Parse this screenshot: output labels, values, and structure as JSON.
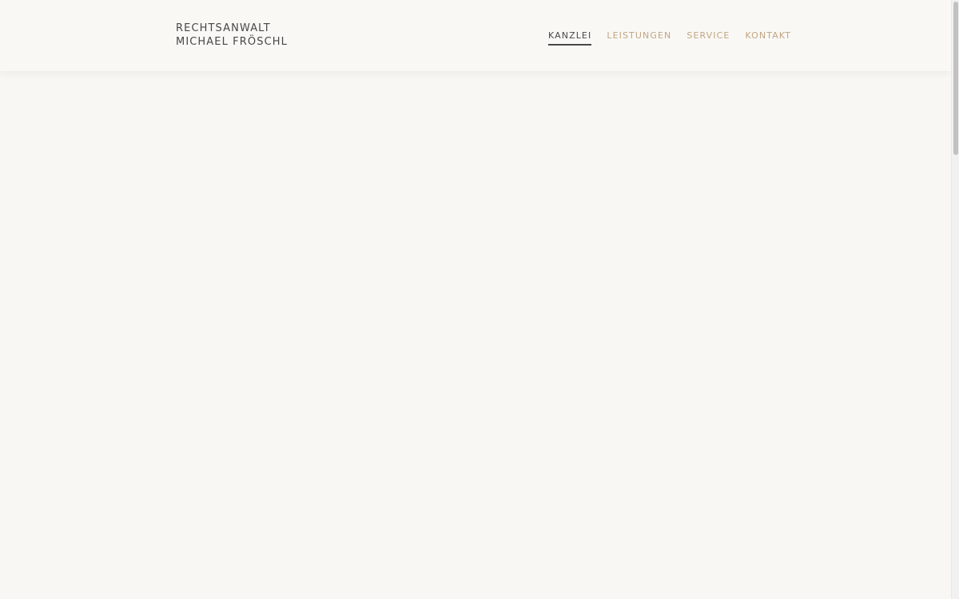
{
  "brand": {
    "line1": "RECHTSANWALT",
    "line2": "MICHAEL FRÖSCHL"
  },
  "nav": {
    "items": [
      {
        "label": "KANZLEI",
        "active": true
      },
      {
        "label": "LEISTUNGEN",
        "active": false
      },
      {
        "label": "SERVICE",
        "active": false
      },
      {
        "label": "KONTAKT",
        "active": false
      }
    ]
  },
  "colors": {
    "background": "#f8f7f4",
    "text_dark": "#4a4746",
    "accent": "#c2a582"
  }
}
